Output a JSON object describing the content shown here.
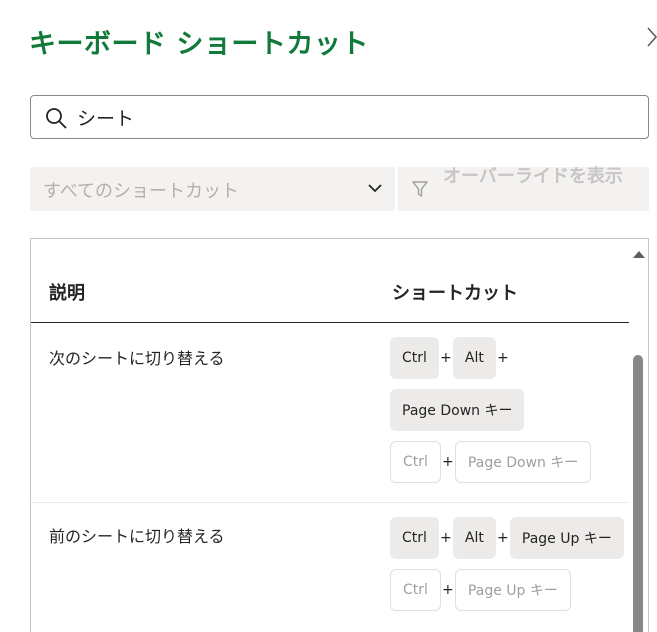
{
  "panel": {
    "title": "キーボード ショートカット",
    "collapse_icon": "chevron-right-icon"
  },
  "search": {
    "icon": "search-icon",
    "value": "シート"
  },
  "filter": {
    "selected": "すべてのショートカット",
    "icon": "chevron-down-icon"
  },
  "override": {
    "icon": "filter-icon",
    "label": "オーバーライドを表示"
  },
  "table": {
    "headers": {
      "description": "説明",
      "shortcut": "ショートカット"
    },
    "rows": [
      {
        "description": "次のシートに切り替える",
        "lines": [
          [
            "Ctrl",
            "Alt"
          ],
          [
            "Page Down キー"
          ],
          [
            "Ctrl",
            "Page Down キー"
          ]
        ]
      },
      {
        "description": "前のシートに切り替える",
        "lines": [
          [
            "Ctrl",
            "Alt",
            "Page Up キー"
          ],
          [
            "Ctrl",
            "Page Up キー"
          ]
        ]
      }
    ],
    "plus": "+"
  },
  "colors": {
    "title": "#117a3a",
    "key_bg": "#edebe9",
    "disabled_text": "#b3b0ad"
  }
}
